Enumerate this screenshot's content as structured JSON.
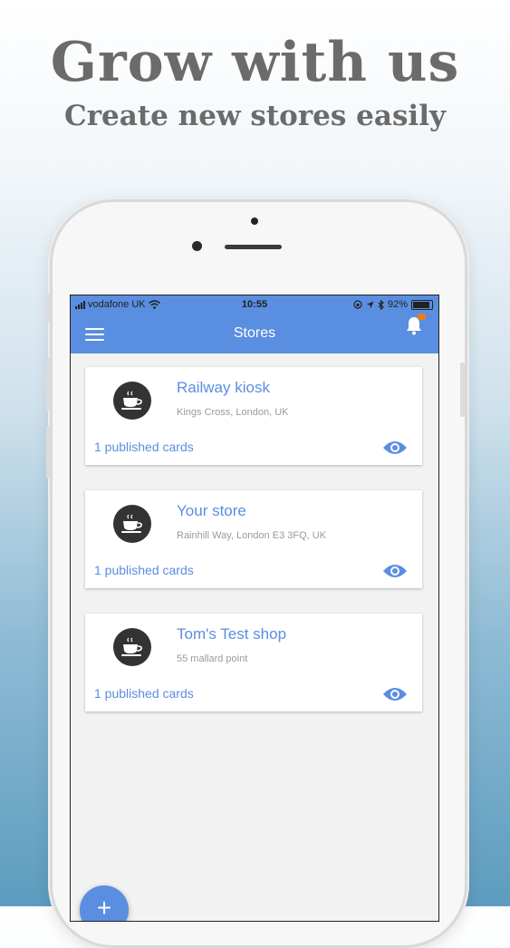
{
  "promo": {
    "headline": "Grow with us",
    "subline": "Create new stores easily"
  },
  "status_bar": {
    "carrier": "vodafone UK",
    "time": "10:55",
    "battery": "92%",
    "icons": [
      "signal-icon",
      "wifi-icon",
      "lock-rotation-icon",
      "location-icon",
      "bluetooth-icon",
      "battery-icon"
    ]
  },
  "app_bar": {
    "title": "Stores",
    "menu_icon": "hamburger-menu-icon",
    "notification_icon": "bell-icon"
  },
  "stores": [
    {
      "name": "Railway kiosk",
      "address": "Kings Cross, London, UK",
      "published": "1 published cards"
    },
    {
      "name": "Your store",
      "address": "Rainhill Way, London E3 3FQ, UK",
      "published": "1 published cards"
    },
    {
      "name": "Tom's Test shop",
      "address": "55 mallard point",
      "published": "1 published cards"
    }
  ],
  "fab": {
    "label": "+"
  },
  "colors": {
    "primary": "#5a8ee0",
    "headline": "#6b6b6b",
    "avatar": "#333333",
    "badge": "#e67e22"
  }
}
